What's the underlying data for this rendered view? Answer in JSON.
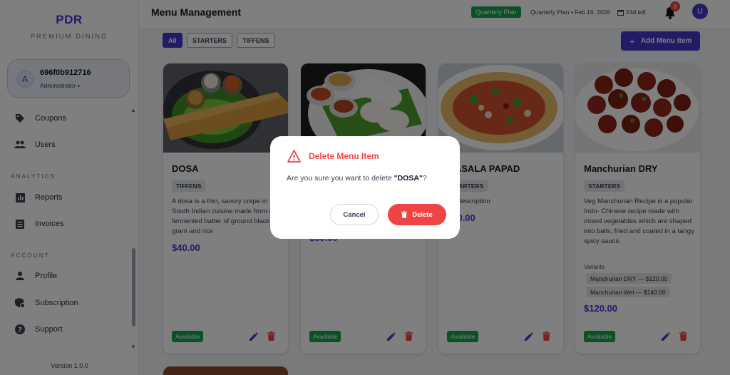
{
  "brand": {
    "name": "PDR",
    "subtitle": "PREMIUM DINING"
  },
  "user": {
    "avatar_letter": "A",
    "name": "696f0b912716",
    "role": "Administrator"
  },
  "sidebar": {
    "items_top": [
      {
        "label": "Coupons",
        "icon": "tag-icon"
      },
      {
        "label": "Users",
        "icon": "users-icon"
      }
    ],
    "analytics_label": "ANALYTICS",
    "analytics_items": [
      {
        "label": "Reports",
        "icon": "bar-chart-icon"
      },
      {
        "label": "Invoices",
        "icon": "invoice-icon"
      }
    ],
    "account_label": "ACCOUNT",
    "account_items": [
      {
        "label": "Profile",
        "icon": "person-icon"
      },
      {
        "label": "Subscription",
        "icon": "subscription-icon"
      },
      {
        "label": "Support",
        "icon": "help-icon"
      }
    ],
    "version": "Version 1.0.0"
  },
  "header": {
    "title": "Menu Management",
    "plan_badge": "Quarterly Plan",
    "plan_info": "Quarterly Plan • Feb 19, 2026",
    "days_left": "24d left",
    "notifications": "8",
    "user_letter": "U"
  },
  "filters": [
    "All",
    "STARTERS",
    "TIFFENS"
  ],
  "add_button": "Add Menu Item",
  "cards": [
    {
      "title": "DOSA",
      "tag": "TIFFENS",
      "description": "A dosa is a thin, savory crepe in South Indian cuisine made from a fermented batter of ground black gram and rice",
      "price": "$40.00",
      "status": "Available"
    },
    {
      "title": "",
      "tag": "",
      "description": "",
      "price": "$50.00",
      "status": "Available"
    },
    {
      "title": "MASALA PAPAD",
      "tag": "STARTERS",
      "description": "No description",
      "price": "$30.00",
      "status": "Available"
    },
    {
      "title": "Manchurian DRY",
      "tag": "STARTERS",
      "description": "Veg Manchurian Recipe is a popular Indo- Chinese recipe made with mixed vegetables which are shaped into balls, fried and coated in a tangy spicy sauce.",
      "variants_label": "Variants:",
      "variants": [
        "Manchurian DRY — $120.00",
        "Manchurian Wet — $140.00"
      ],
      "price": "$120.00",
      "status": "Available"
    }
  ],
  "modal": {
    "title": "Delete Menu Item",
    "message_prefix": "Are you sure you want to delete ",
    "item_name": "\"DOSA\"",
    "message_suffix": "?",
    "cancel": "Cancel",
    "delete": "Delete"
  },
  "colors": {
    "accent": "#4338ca",
    "danger": "#ef4444",
    "success": "#16a34a"
  }
}
